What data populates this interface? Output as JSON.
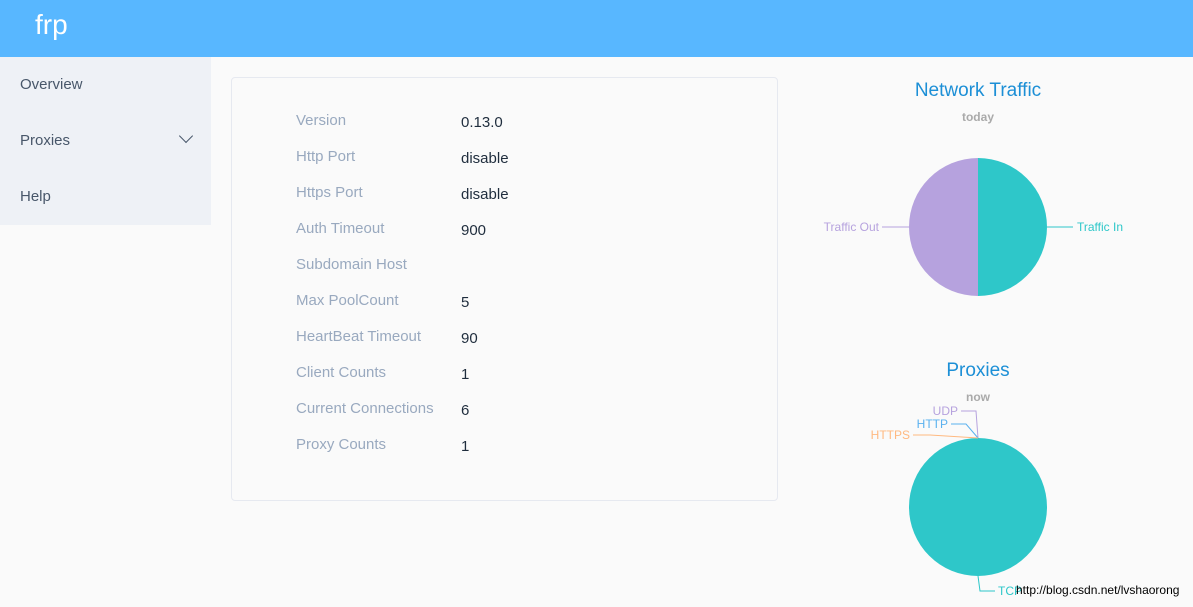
{
  "header": {
    "title": "frp"
  },
  "sidebar": {
    "items": [
      {
        "label": "Overview"
      },
      {
        "label": "Proxies"
      },
      {
        "label": "Help"
      }
    ]
  },
  "overview": [
    {
      "label": "Version",
      "value": "0.13.0"
    },
    {
      "label": "Http Port",
      "value": "disable"
    },
    {
      "label": "Https Port",
      "value": "disable"
    },
    {
      "label": "Auth Timeout",
      "value": "900"
    },
    {
      "label": "Subdomain Host",
      "value": ""
    },
    {
      "label": "Max PoolCount",
      "value": "5"
    },
    {
      "label": "HeartBeat Timeout",
      "value": "90"
    },
    {
      "label": "Client Counts",
      "value": "1"
    },
    {
      "label": "Current Connections",
      "value": "6"
    },
    {
      "label": "Proxy Counts",
      "value": "1"
    }
  ],
  "chart_data": [
    {
      "type": "pie",
      "title": "Network Traffic",
      "subtitle": "today",
      "categories": [
        "Traffic In",
        "Traffic Out"
      ],
      "values": [
        1,
        1
      ],
      "colors": [
        "#2ec7c9",
        "#b6a2de"
      ]
    },
    {
      "type": "pie",
      "title": "Proxies",
      "subtitle": "now",
      "categories": [
        "TCP",
        "UDP",
        "HTTP",
        "HTTPS"
      ],
      "values": [
        1,
        0,
        0,
        0
      ],
      "colors": [
        "#2ec7c9",
        "#b6a2de",
        "#5ab1ef",
        "#ffb980"
      ]
    }
  ],
  "watermark": "http://blog.csdn.net/lvshaorong"
}
